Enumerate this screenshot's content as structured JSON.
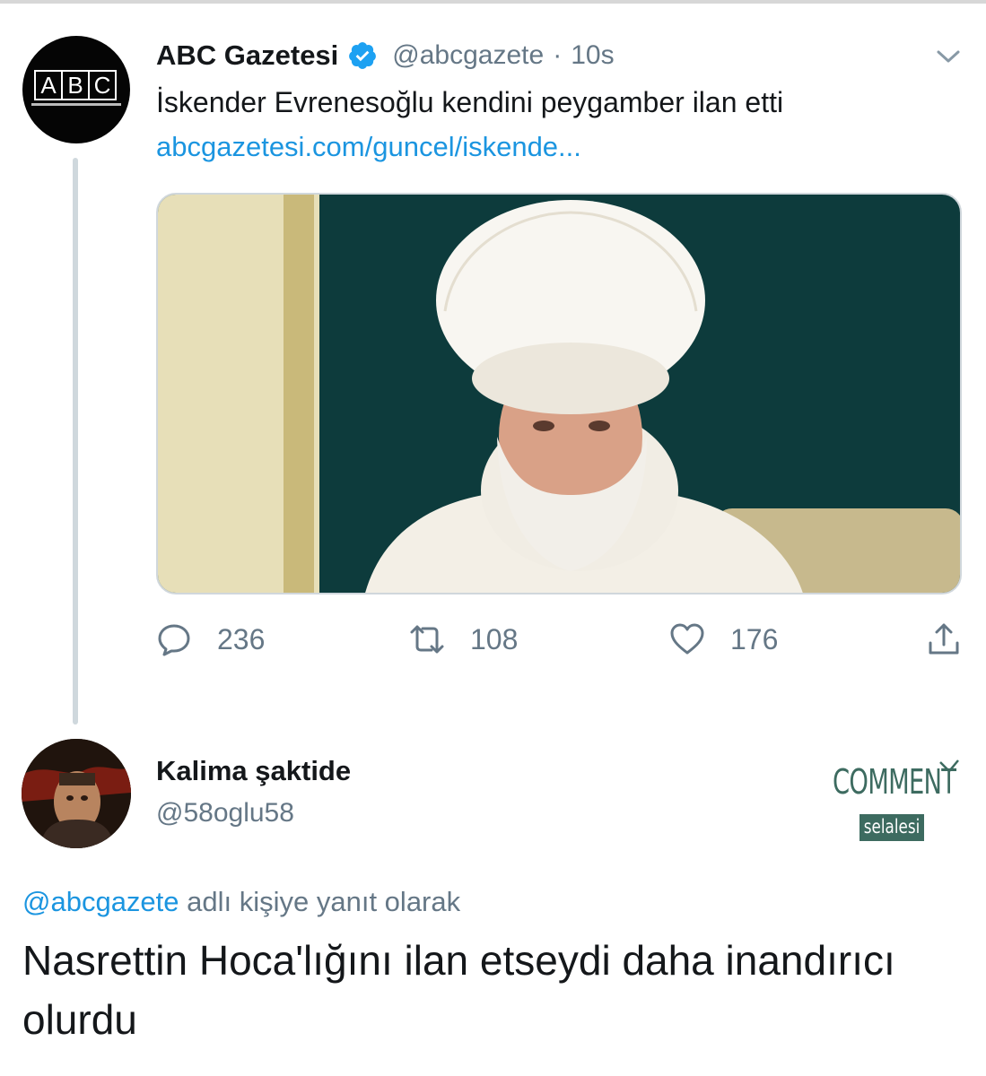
{
  "tweet": {
    "display_name": "ABC Gazetesi",
    "handle": "@abcgazete",
    "separator": "·",
    "time": "10s",
    "text": "İskender Evrenesoğlu kendini peygamber ilan etti",
    "link": "abcgazetesi.com/guncel/iskende...",
    "avatar_letters": [
      "A",
      "B",
      "C"
    ],
    "actions": {
      "replies": "236",
      "retweets": "108",
      "likes": "176"
    }
  },
  "reply": {
    "display_name": "Kalima şaktide",
    "handle": "@58oglu58",
    "context_mention": "@abcgazete",
    "context_suffix": " adlı kişiye yanıt olarak",
    "text": "Nasrettin Hoca'lığını ilan etseydi daha inandırıcı olurdu"
  },
  "watermark": {
    "main": "COMMENT",
    "sub": "selalesi"
  },
  "icons": [
    "verified-badge-icon",
    "chevron-down-icon",
    "reply-icon",
    "retweet-icon",
    "like-icon",
    "share-icon"
  ],
  "colors": {
    "link_blue": "#1b95e0",
    "secondary_text": "#657786",
    "verified_blue": "#1da1f2",
    "watermark_green": "#3d6b60"
  }
}
